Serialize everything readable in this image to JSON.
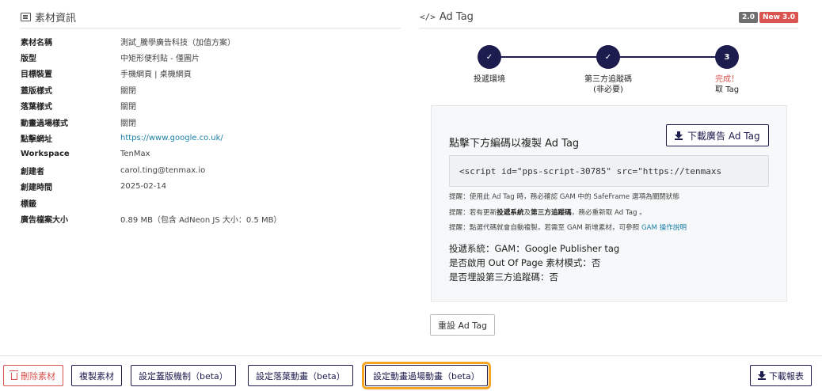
{
  "material_info": {
    "title": "素材資訊",
    "rows": [
      {
        "label": "素材名稱",
        "value": "測試_騰學廣告科技（加值方案）"
      },
      {
        "label": "版型",
        "value": "中矩形便利貼 - 僅圖片"
      },
      {
        "label": "目標裝置",
        "value": "手機網頁 | 桌機網頁"
      },
      {
        "label": "蓋版樣式",
        "value": "關閉"
      },
      {
        "label": "落葉樣式",
        "value": "關閉"
      },
      {
        "label": "動畫過場樣式",
        "value": "關閉"
      },
      {
        "label": "點擊網址",
        "value": "https://www.google.co.uk/"
      },
      {
        "label": "Workspace",
        "value": "TenMax"
      },
      {
        "label": "創建者",
        "value": "carol.ting@tenmax.io"
      },
      {
        "label": "創建時間",
        "value": "2025-02-14"
      },
      {
        "label": "標籤",
        "value": ""
      },
      {
        "label": "廣告檔案大小",
        "value": "0.89 MB（包含 AdNeon JS 大小：0.5 MB）"
      }
    ]
  },
  "ad_tag": {
    "title": "Ad Tag",
    "version_badges": [
      "2.0",
      "New 3.0"
    ],
    "steps": [
      {
        "symbol": "✓",
        "line1": "投遞環境",
        "line2": ""
      },
      {
        "symbol": "✓",
        "line1": "第三方追蹤碼",
        "line2": "(非必要)"
      },
      {
        "symbol": "3",
        "line1": "完成！",
        "line2": "取 Tag"
      }
    ],
    "copy_title": "點擊下方編碼以複製 Ad Tag",
    "download_label": "下載廣告 Ad Tag",
    "code_value": "<script id=\"pps-script-30785\" src=\"https://tenmaxs",
    "notes": {
      "n1": "提醒：使用此 Ad Tag 時，務必確認 GAM 中的 SafeFrame 選項為關閉狀態",
      "n2a": "提醒：若有更新",
      "n2b": "投遞系統",
      "n2c": "及",
      "n2d": "第三方追蹤碼",
      "n2e": "，務必重新取 Ad Tag 。",
      "n3a": "提醒：點選代碼就會自動複製，若需至 GAM 新增素材，可參照 ",
      "n3b": "GAM 操作說明"
    },
    "summary": [
      "投遞系統：GAM：Google Publisher tag",
      "是否啟用 Out Of Page 素材模式：否",
      "是否埋設第三方追蹤碼：否"
    ],
    "reset_label": "重設 Ad Tag"
  },
  "footer": {
    "delete_label": "刪除素材",
    "copy_label": "複製素材",
    "cover_label": "設定蓋版機制（beta）",
    "leaf_label": "設定落葉動畫（beta）",
    "transition_label": "設定動畫過場動畫（beta）",
    "report_label": "下載報表"
  },
  "colors": {
    "primary": "#1c1c4f",
    "danger": "#d9534f",
    "highlight": "#f5a623",
    "link": "#1a7fa8"
  }
}
